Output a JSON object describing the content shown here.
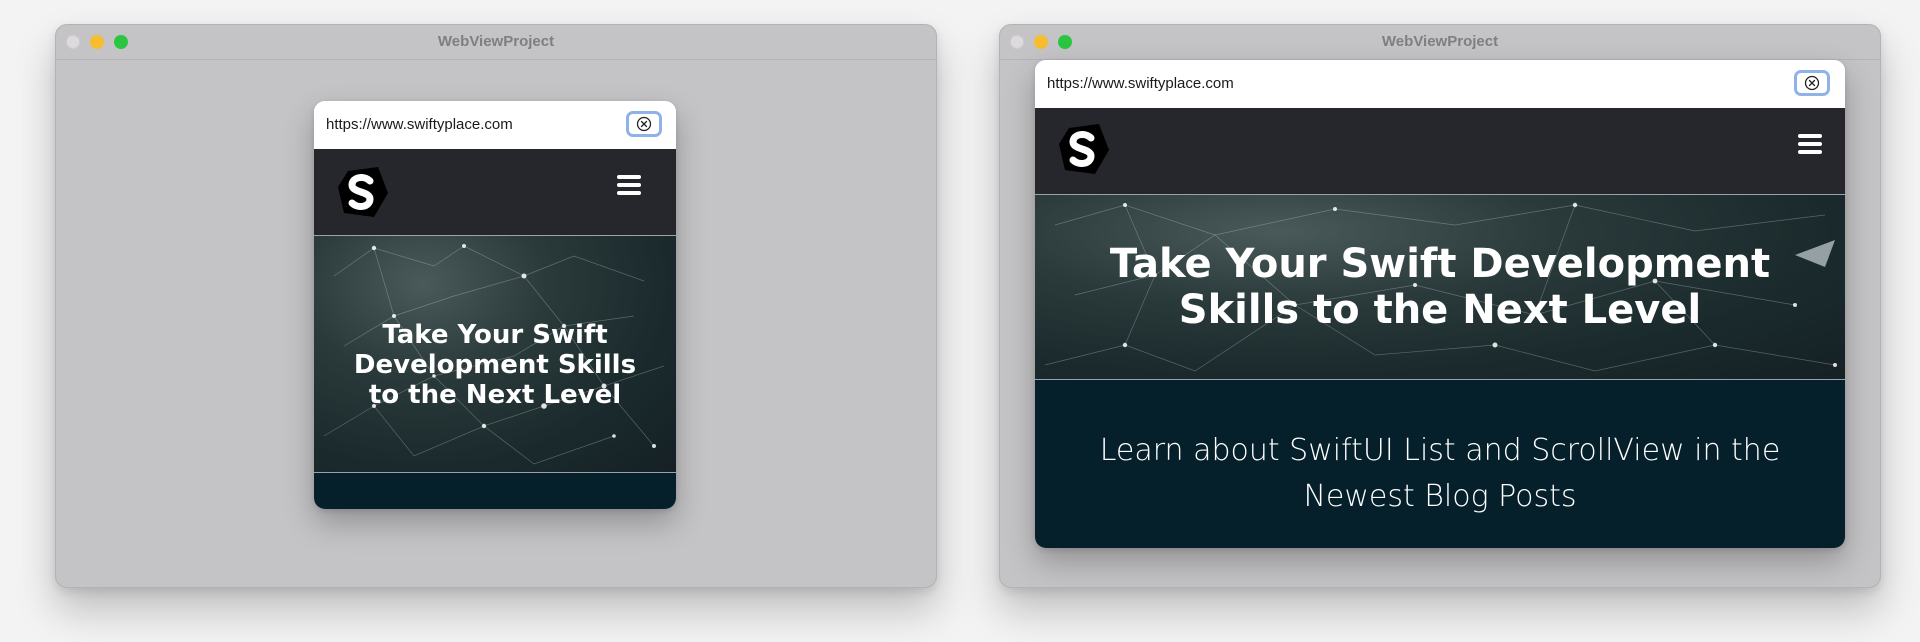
{
  "windows": [
    {
      "title": "WebViewProject",
      "url": "https://www.swiftyplace.com",
      "hero_title": "Take Your Swift Development Skills to the Next Level",
      "blog_text": ""
    },
    {
      "title": "WebViewProject",
      "url": "https://www.swiftyplace.com",
      "hero_title": "Take Your Swift Development Skills to the Next Level",
      "blog_text": "Learn about SwiftUI List and ScrollView in the Newest Blog Posts"
    }
  ],
  "icons": {
    "clear": "xmark-circle-icon",
    "menu": "hamburger-menu-icon",
    "logo": "swiftyplace-logo"
  },
  "colors": {
    "window_bg": "#c4c3c5",
    "site_header": "#26272d",
    "teal_section": "#05202a",
    "focus_ring": "#8fb2e8",
    "traffic_min": "#f6bd2f",
    "traffic_max": "#2bc641"
  }
}
